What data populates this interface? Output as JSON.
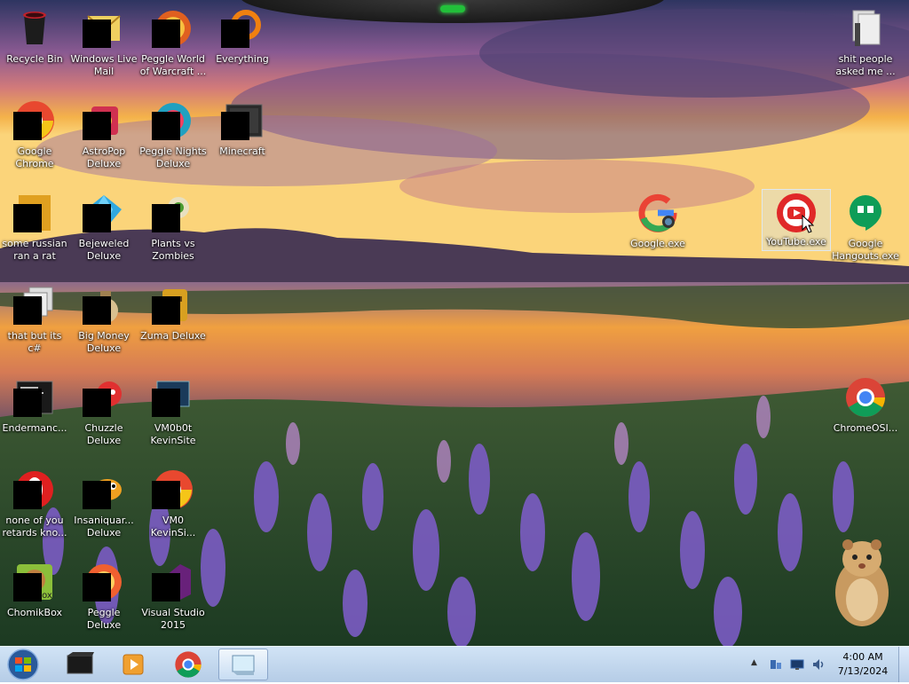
{
  "desktop": {
    "icons": [
      {
        "label": "Recycle Bin",
        "icon": "recycle-bin-icon",
        "redacted": false
      },
      {
        "label": "Windows Live Mail",
        "icon": "mail-icon",
        "redacted": true
      },
      {
        "label": "Peggle World of Warcraft ...",
        "icon": "peggle-icon",
        "redacted": true
      },
      {
        "label": "Everything",
        "icon": "search-magnifier-icon",
        "redacted": true
      },
      {
        "label": "Google Chrome",
        "icon": "chrome-icon",
        "redacted": true
      },
      {
        "label": "AstroPop Deluxe",
        "icon": "astropop-icon",
        "redacted": true
      },
      {
        "label": "Peggle Nights Deluxe",
        "icon": "peggle-nights-icon",
        "redacted": true
      },
      {
        "label": "Minecraft",
        "icon": "minecraft-icon",
        "redacted": true
      },
      {
        "label": "some russian ran a rat",
        "icon": "java-jar-icon",
        "redacted": true
      },
      {
        "label": "Bejeweled Deluxe",
        "icon": "gem-icon",
        "redacted": true
      },
      {
        "label": "Plants vs Zombies",
        "icon": "plant-icon",
        "redacted": true
      },
      {
        "label": "that but its c#",
        "icon": "shortcut-stack-icon",
        "redacted": true
      },
      {
        "label": "Big Money Deluxe",
        "icon": "money-bag-icon",
        "redacted": true
      },
      {
        "label": "Zuma Deluxe",
        "icon": "zuma-idol-icon",
        "redacted": true
      },
      {
        "label": "Endermanc...",
        "icon": "terminal-icon",
        "redacted": true
      },
      {
        "label": "Chuzzle Deluxe",
        "icon": "chuzzle-icon",
        "redacted": true
      },
      {
        "label": "VM0b0t KevinSite",
        "icon": "vm-monitor-icon",
        "redacted": true
      },
      {
        "label": "none of you retards kno...",
        "icon": "opera-icon",
        "redacted": true
      },
      {
        "label": "Insaniquar... Deluxe",
        "icon": "fish-icon",
        "redacted": true
      },
      {
        "label": "VM0 KevinSi...",
        "icon": "chrome-icon",
        "redacted": true
      },
      {
        "label": "ChomikBox",
        "icon": "chomik-icon",
        "redacted": true
      },
      {
        "label": "Peggle Deluxe",
        "icon": "peggle-ball-icon",
        "redacted": true
      },
      {
        "label": "Visual Studio 2015",
        "icon": "visual-studio-icon",
        "redacted": true
      },
      {
        "label": "shit people asked me ...",
        "icon": "folder-icon",
        "redacted": false
      },
      {
        "label": "Google.exe",
        "icon": "google-g-icon",
        "redacted": false
      },
      {
        "label": "YouTube.exe",
        "icon": "youtube-icon",
        "redacted": false,
        "selected": true
      },
      {
        "label": "Google Hangouts.exe",
        "icon": "hangouts-icon",
        "redacted": false
      },
      {
        "label": "ChromeOSI...",
        "icon": "chrome-icon",
        "redacted": false
      }
    ]
  },
  "taskbar": {
    "pinned": [
      {
        "name": "start-orb-icon"
      },
      {
        "name": "terminal-window-icon"
      },
      {
        "name": "media-player-icon"
      },
      {
        "name": "chrome-icon"
      },
      {
        "name": "paint-window-icon"
      }
    ],
    "tray": {
      "show_hidden": "▲",
      "icons": [
        "network-icon",
        "display-icon",
        "volume-icon"
      ]
    },
    "clock": {
      "time": "4:00 AM",
      "date": "7/13/2024"
    }
  },
  "colors": {
    "sky_top": "#3a3a6e",
    "sunset_orange": "#f2a23a",
    "flowers": "#7b5cc4",
    "taskbar": "#c8dcf0"
  }
}
